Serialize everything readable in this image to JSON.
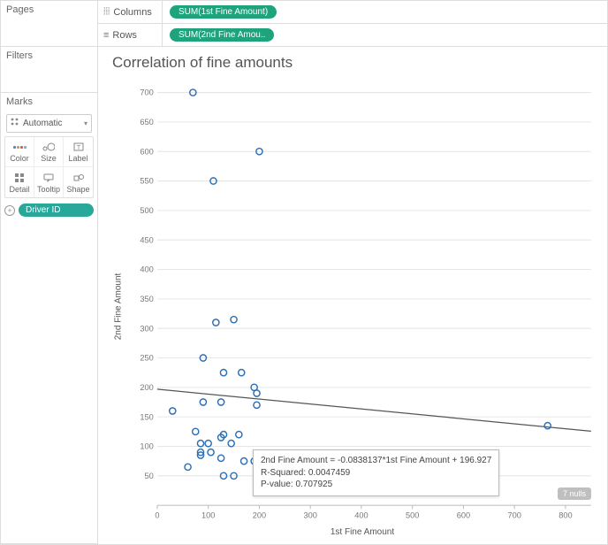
{
  "left": {
    "pages_label": "Pages",
    "filters_label": "Filters",
    "marks_label": "Marks",
    "marks_type_label": "Automatic",
    "grid": {
      "color": "Color",
      "size": "Size",
      "label": "Label",
      "detail": "Detail",
      "tooltip": "Tooltip",
      "shape": "Shape"
    },
    "detail_pill": "Driver ID"
  },
  "shelves": {
    "columns_label": "Columns",
    "rows_label": "Rows",
    "columns_pill": "SUM(1st Fine Amount)",
    "rows_pill": "SUM(2nd Fine Amou.."
  },
  "viz": {
    "title": "Correlation of fine amounts",
    "xlabel": "1st Fine Amount",
    "ylabel": "2nd Fine Amount",
    "nulls_label": "7 nulls",
    "tooltip_eq": "2nd Fine Amount = -0.0838137*1st Fine Amount + 196.927",
    "tooltip_r2": "R-Squared: 0.0047459",
    "tooltip_p": "P-value: 0.707925"
  },
  "chart_data": {
    "type": "scatter",
    "xlabel": "1st Fine Amount",
    "ylabel": "2nd Fine Amount",
    "xlim": [
      0,
      850
    ],
    "ylim": [
      0,
      720
    ],
    "xticks": [
      0,
      100,
      200,
      300,
      400,
      500,
      600,
      700,
      800
    ],
    "yticks": [
      50,
      100,
      150,
      200,
      250,
      300,
      350,
      400,
      450,
      500,
      550,
      600,
      650,
      700
    ],
    "points": [
      {
        "x": 70,
        "y": 700
      },
      {
        "x": 200,
        "y": 600
      },
      {
        "x": 110,
        "y": 550
      },
      {
        "x": 150,
        "y": 315
      },
      {
        "x": 115,
        "y": 310
      },
      {
        "x": 90,
        "y": 250
      },
      {
        "x": 130,
        "y": 225
      },
      {
        "x": 165,
        "y": 225
      },
      {
        "x": 190,
        "y": 200
      },
      {
        "x": 195,
        "y": 190
      },
      {
        "x": 195,
        "y": 170
      },
      {
        "x": 125,
        "y": 175
      },
      {
        "x": 90,
        "y": 175
      },
      {
        "x": 30,
        "y": 160
      },
      {
        "x": 765,
        "y": 135
      },
      {
        "x": 75,
        "y": 125
      },
      {
        "x": 130,
        "y": 120
      },
      {
        "x": 160,
        "y": 120
      },
      {
        "x": 125,
        "y": 115
      },
      {
        "x": 85,
        "y": 105
      },
      {
        "x": 100,
        "y": 105
      },
      {
        "x": 145,
        "y": 105
      },
      {
        "x": 85,
        "y": 90
      },
      {
        "x": 105,
        "y": 90
      },
      {
        "x": 85,
        "y": 85
      },
      {
        "x": 125,
        "y": 80
      },
      {
        "x": 190,
        "y": 75
      },
      {
        "x": 170,
        "y": 75
      },
      {
        "x": 60,
        "y": 65
      },
      {
        "x": 130,
        "y": 50
      },
      {
        "x": 150,
        "y": 50
      }
    ],
    "trend": {
      "slope": -0.0838137,
      "intercept": 196.927
    }
  }
}
